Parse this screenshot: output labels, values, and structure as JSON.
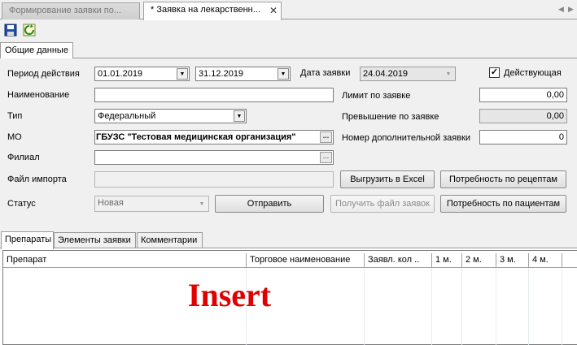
{
  "doc_tabs": [
    {
      "label": "Формирование  заявки по...",
      "active": false
    },
    {
      "label": "* Заявка на лекарственн...",
      "active": true
    }
  ],
  "toolbar": {
    "save_icon": "save-icon",
    "refresh_icon": "refresh-icon"
  },
  "section_tab": "Общие данные",
  "form": {
    "period_label": "Период действия",
    "period_from": "01.01.2019",
    "period_to": "31.12.2019",
    "request_date_label": "Дата заявки",
    "request_date": "24.04.2019",
    "active_label": "Действующая",
    "active_checked": "✓",
    "name_label": "Наименование",
    "name_value": "",
    "type_label": "Тип",
    "type_value": "Федеральный",
    "mo_label": "МО",
    "mo_value": "ГБУЗС \"Тестовая медицинская организация\"",
    "branch_label": "Филиал",
    "branch_value": "",
    "import_label": "Файл импорта",
    "import_value": "",
    "status_label": "Статус",
    "status_value": "Новая",
    "limit_label": "Лимит по заявке",
    "limit_value": "0,00",
    "excess_label": "Превышение по заявке",
    "excess_value": "0,00",
    "extra_label": "Номер дополнительной заявки",
    "extra_value": "0"
  },
  "buttons": {
    "export_excel": "Выгрузить в Excel",
    "need_recipes": "Потребность  по рецептам",
    "send": "Отправить",
    "get_file": "Получить  файл заявок",
    "need_patients": "Потребность  по пациентам",
    "dots": "..."
  },
  "sub_tabs": [
    "Препараты",
    "Элементы заявки",
    "Комментарии"
  ],
  "grid": {
    "columns": [
      "Препарат",
      "Торговое наименование",
      "Заявл. кол ..",
      "1 м.",
      "2 м.",
      "3 м.",
      "4 м."
    ]
  },
  "overlay_text": "Insert"
}
